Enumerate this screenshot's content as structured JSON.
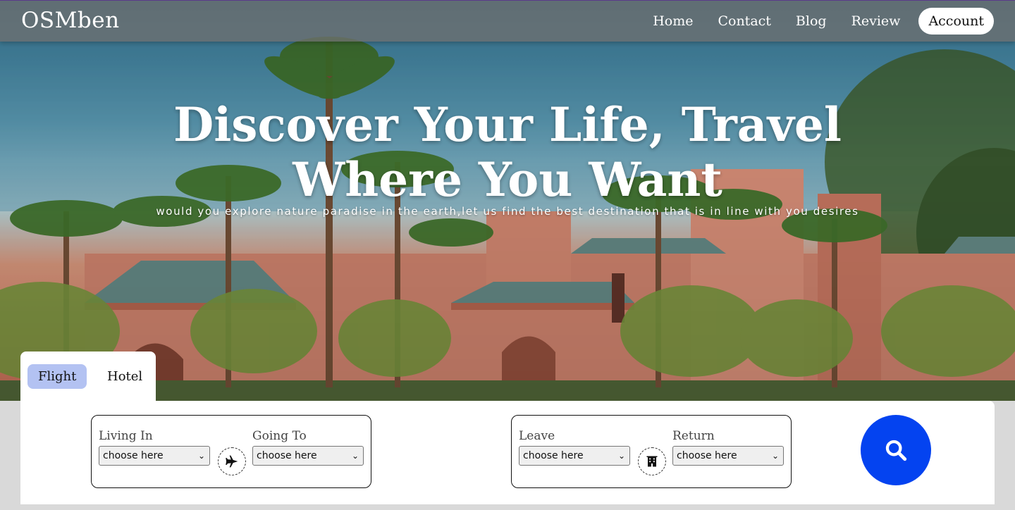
{
  "brand": {
    "name": "OSMben"
  },
  "nav": {
    "items": [
      {
        "label": "Home"
      },
      {
        "label": "Contact"
      },
      {
        "label": "Blog"
      },
      {
        "label": "Review"
      }
    ],
    "account_label": "Account"
  },
  "hero": {
    "headline_line1": "Discover Your Life, Travel",
    "headline_line2": "Where You Want",
    "subtitle": "would you explore nature paradise in the earth,let us find the best destination that is in line with you desires"
  },
  "booking": {
    "tabs": [
      {
        "label": "Flight",
        "active": true
      },
      {
        "label": "Hotel",
        "active": false
      }
    ],
    "flight_group": {
      "from_label": "Living In",
      "from_value": "choose here",
      "to_label": "Going To",
      "to_value": "choose here",
      "icon": "airplane-icon"
    },
    "date_group": {
      "leave_label": "Leave",
      "leave_value": "choose here",
      "return_label": "Return",
      "return_value": "choose here",
      "icon": "building-icon"
    },
    "search_icon": "search-icon"
  },
  "colors": {
    "accent": "#0443f0",
    "active_tab": "#b3c2f2",
    "topbar": "#6e7070"
  }
}
